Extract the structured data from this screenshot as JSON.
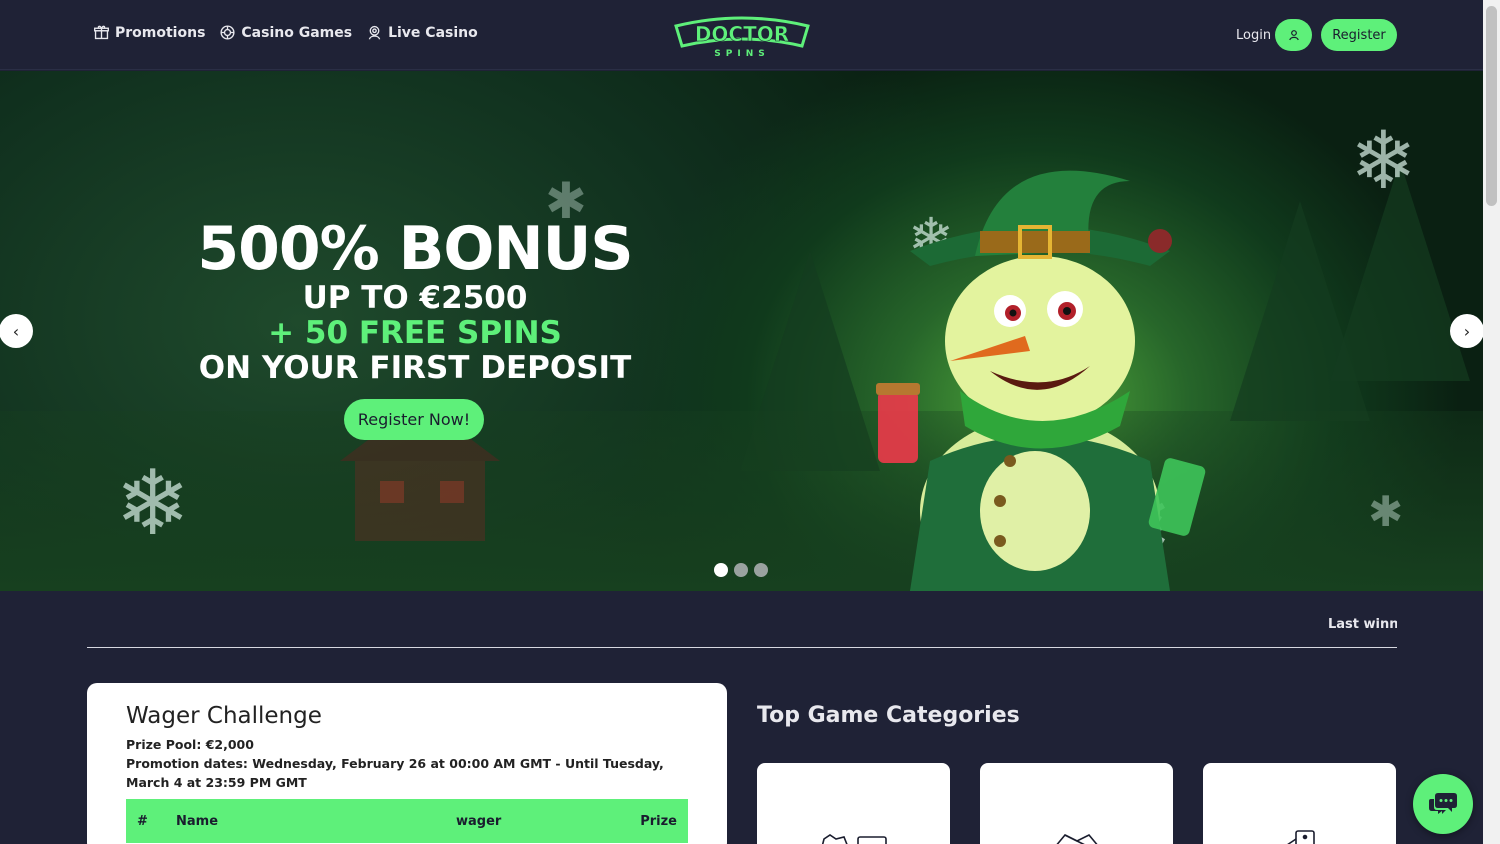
{
  "header": {
    "nav": [
      {
        "label": "Promotions",
        "icon": "gift-icon"
      },
      {
        "label": "Casino Games",
        "icon": "casino-chip-icon"
      },
      {
        "label": "Live Casino",
        "icon": "live-dealer-icon"
      }
    ],
    "logo_top": "DOCTOR",
    "logo_bottom": "SPINS",
    "login_label": "Login",
    "register_label": "Register"
  },
  "hero": {
    "headline": "500% BONUS",
    "line1": "UP TO €2500",
    "line2": "+ 50 FREE SPINS",
    "line3": "ON YOUR FIRST DEPOSIT",
    "cta_label": "Register Now!",
    "prev_arrow": "‹",
    "next_arrow": "›",
    "slides_total": 3,
    "active_slide": 1
  },
  "ticker": {
    "text": "Last winners"
  },
  "wager": {
    "title": "Wager Challenge",
    "prize_pool": "Prize Pool: €2,000",
    "dates": "Promotion dates: Wednesday, February 26 at 00:00 AM GMT - Until Tuesday, March 4 at 23:59 PM GMT",
    "table": {
      "columns": [
        "#",
        "Name",
        "wager",
        "Prize"
      ]
    }
  },
  "categories": {
    "title": "Top Game Categories",
    "cards": [
      {
        "icon": "slot-machine-icon"
      },
      {
        "icon": "table-games-icon"
      },
      {
        "icon": "cards-icon"
      }
    ]
  },
  "colors": {
    "accent": "#5ef07a",
    "background": "#1f2236"
  }
}
